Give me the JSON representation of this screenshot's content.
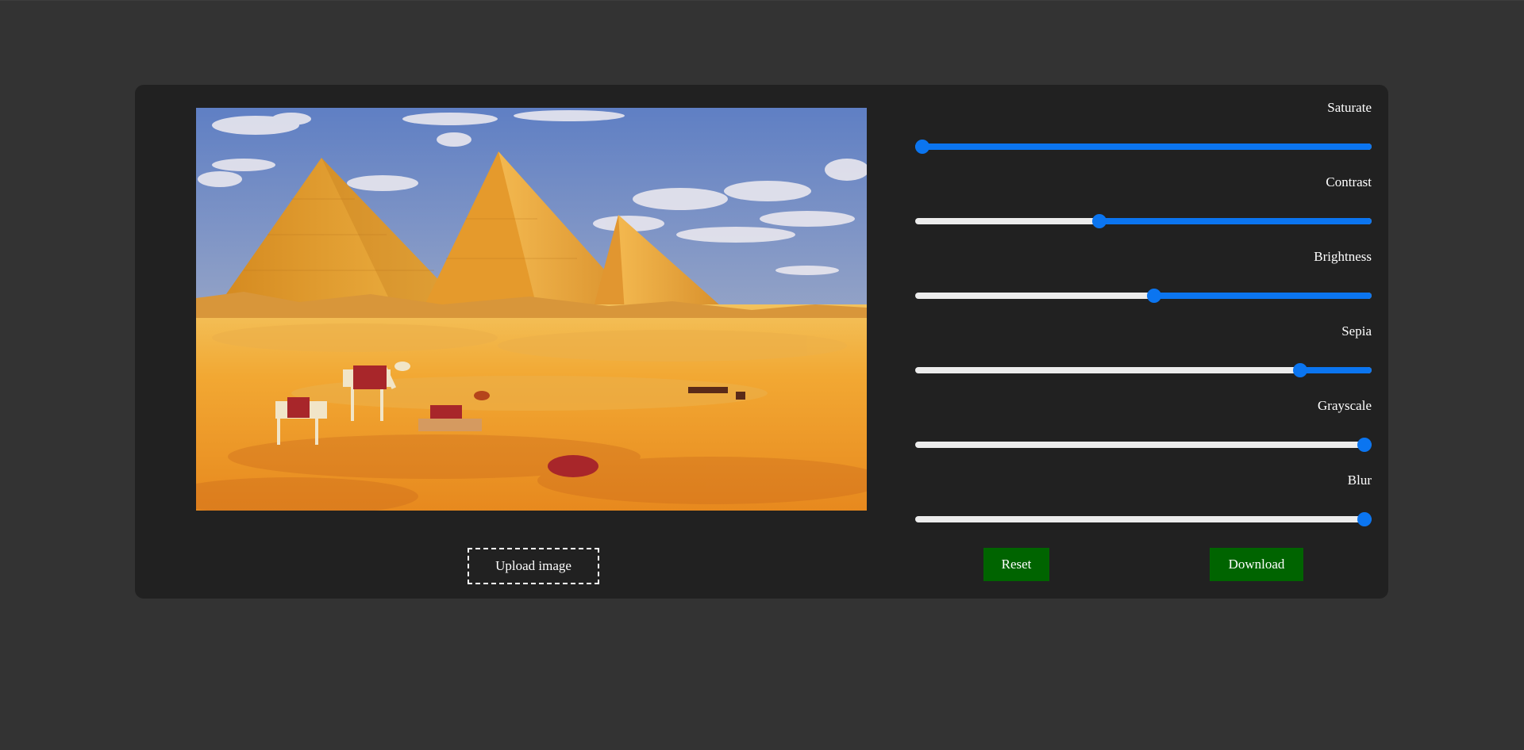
{
  "editor": {
    "upload_label": "Upload image",
    "controls": [
      {
        "label": "Saturate",
        "value": 0.0,
        "fill": "right"
      },
      {
        "label": "Contrast",
        "value": 0.4,
        "fill": "right"
      },
      {
        "label": "Brightness",
        "value": 0.525,
        "fill": "right"
      },
      {
        "label": "Sepia",
        "value": 0.855,
        "fill": "right"
      },
      {
        "label": "Grayscale",
        "value": 1.0,
        "fill": "right"
      },
      {
        "label": "Blur",
        "value": 1.0,
        "fill": "right"
      }
    ],
    "reset_label": "Reset",
    "download_label": "Download"
  },
  "colors": {
    "page_background": "#333333",
    "panel_background": "#212121",
    "slider_accent": "#0b75f0",
    "slider_track": "#ececec",
    "button_green": "#006400"
  },
  "icons": {
    "preview": "image-preview"
  }
}
